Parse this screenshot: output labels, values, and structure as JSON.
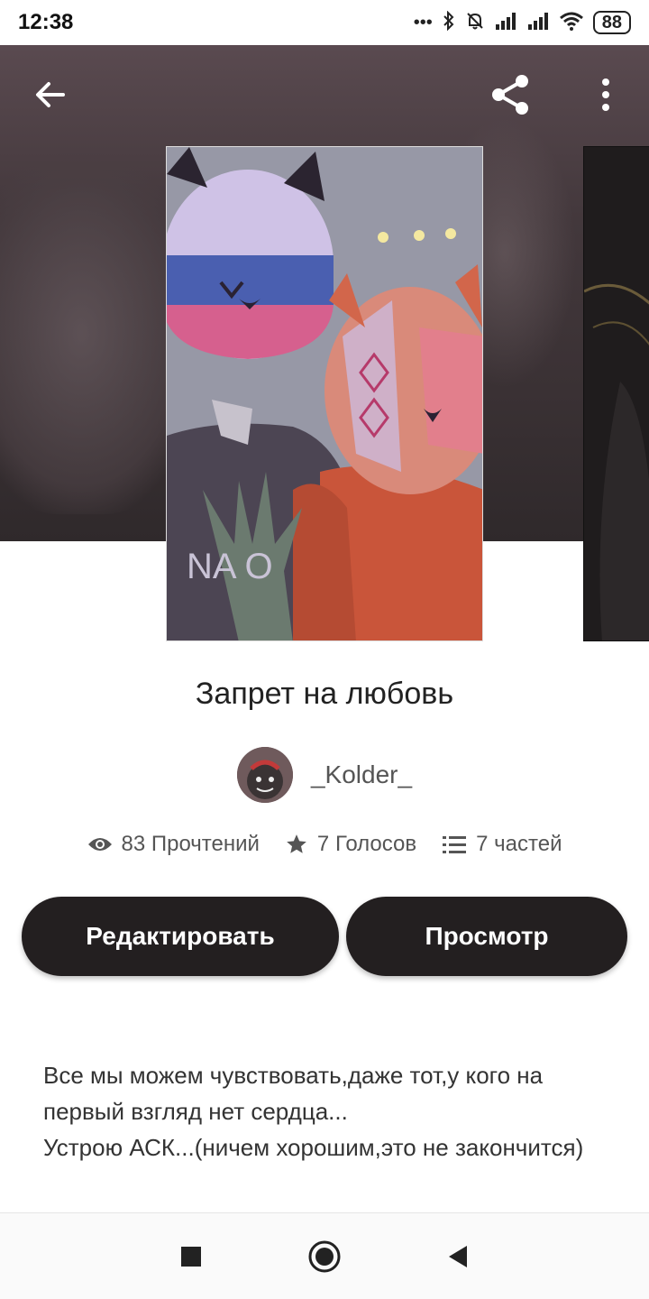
{
  "status_bar": {
    "time": "12:38",
    "icons": [
      "more-dots-icon",
      "bluetooth-icon",
      "bell-off-icon",
      "signal-icon",
      "signal-icon",
      "wifi-icon"
    ],
    "battery": "88"
  },
  "toolbar": {
    "back_icon": "arrow-left-icon",
    "share_icon": "share-icon",
    "more_icon": "more-vertical-icon"
  },
  "book": {
    "title": "Запрет на любовь",
    "author": "_Kolder_",
    "stats": {
      "reads": "83 Прочтений",
      "votes": "7 Голосов",
      "parts": "7 частей"
    },
    "description": [
      "Все мы можем чувствовать,даже тот,у кого на первый взгляд нет сердца...",
      "Устрою АСК...(ничем хорошим,это не закончится)"
    ]
  },
  "cover_text": "NA O",
  "actions": {
    "edit_label": "Редактировать",
    "view_label": "Просмотр"
  },
  "nav": {
    "recents_icon": "square-icon",
    "home_icon": "circle-icon",
    "back_icon": "triangle-back-icon"
  },
  "colors": {
    "button_bg": "#231f20",
    "hero_bg": "#43383c",
    "text_primary": "#222222",
    "text_secondary": "#555555"
  }
}
